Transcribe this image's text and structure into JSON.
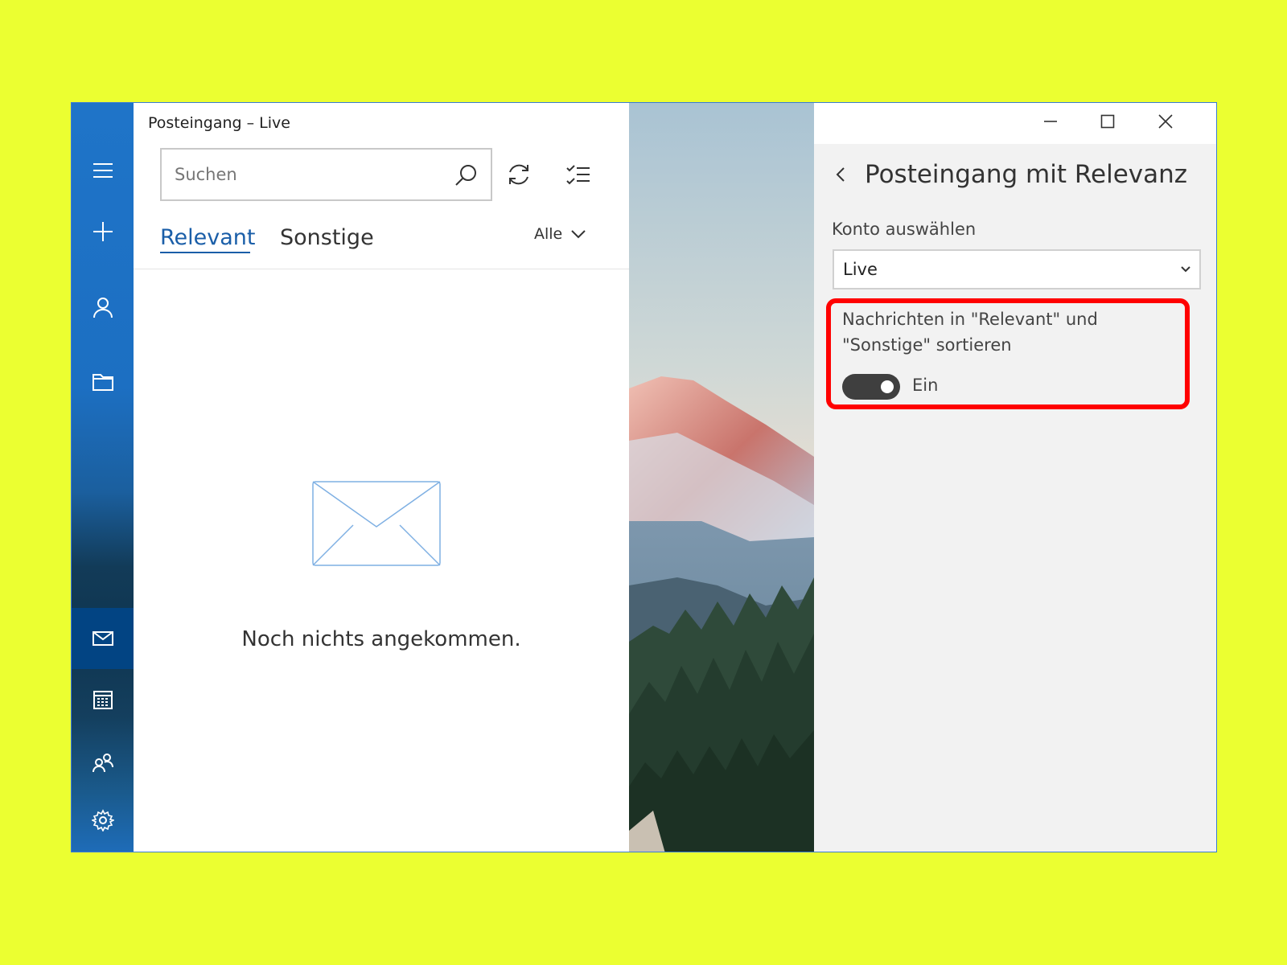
{
  "window": {
    "title": "Posteingang – Live"
  },
  "rail": {
    "items": [
      {
        "icon": "hamburger-menu-icon"
      },
      {
        "icon": "compose-plus-icon"
      },
      {
        "icon": "account-icon"
      },
      {
        "icon": "folder-icon"
      },
      {
        "icon": "mail-icon",
        "active": true
      },
      {
        "icon": "calendar-icon"
      },
      {
        "icon": "people-icon"
      },
      {
        "icon": "settings-gear-icon"
      }
    ]
  },
  "search": {
    "placeholder": "Suchen"
  },
  "tabs": [
    {
      "label": "Relevant",
      "active": true
    },
    {
      "label": "Sonstige",
      "active": false
    }
  ],
  "filter": {
    "selected": "Alle"
  },
  "empty_state": {
    "message": "Noch nichts angekommen."
  },
  "settings_panel": {
    "title": "Posteingang mit Relevanz",
    "account_label": "Konto auswählen",
    "account_selected": "Live",
    "toggle_description": "Nachrichten in \"Relevant\" und \"Sonstige\" sortieren",
    "toggle_on": true,
    "toggle_state_label": "Ein"
  },
  "colors": {
    "background": "#ebff31",
    "accent": "#1a5ea8",
    "rail": "#1f74c8",
    "highlight": "#ff0000",
    "toggle_on": "#3f3f3f"
  }
}
